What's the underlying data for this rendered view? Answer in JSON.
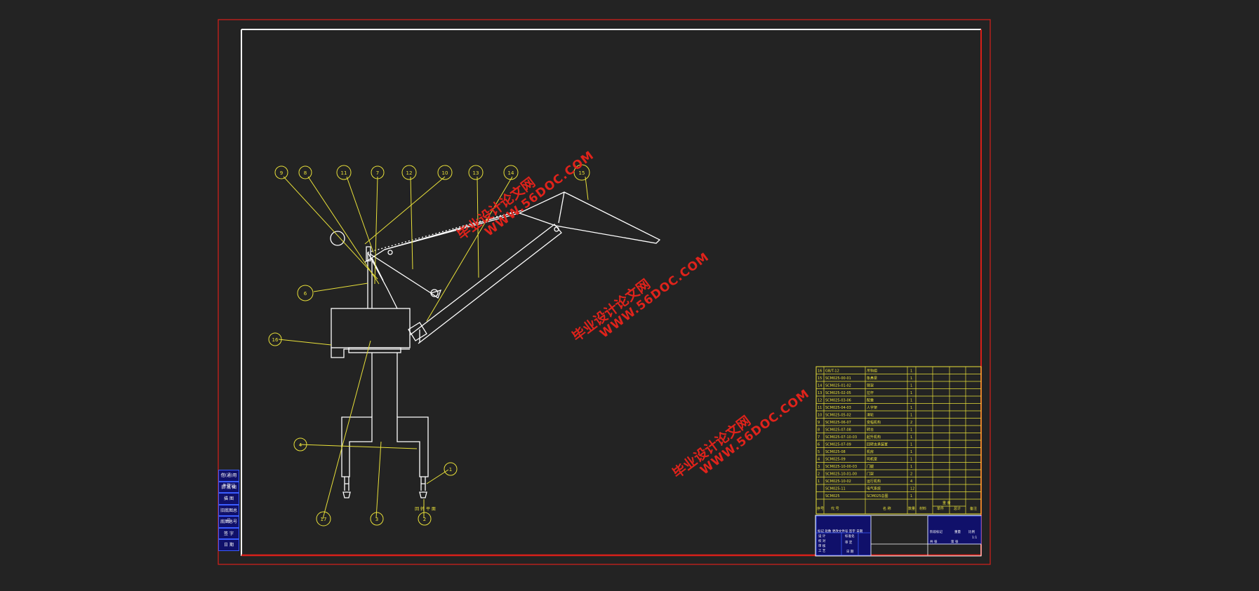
{
  "drawing": {
    "balloons": [
      "9",
      "8",
      "11",
      "7",
      "12",
      "10",
      "13",
      "14",
      "15",
      "16",
      "6",
      "4",
      "17",
      "3",
      "2",
      "1"
    ],
    "ground_note": "回 转 平 面",
    "watermark": {
      "chinese": "毕业设计论文网",
      "url": "WWW.56DOC.COM"
    }
  },
  "side_table": {
    "cells": [
      "借(通)用件登记",
      "旧 底 图",
      "描 图",
      "旧底图总号",
      "底图总号",
      "签 字",
      "日 期"
    ]
  },
  "bom": {
    "rows": [
      {
        "no": "16",
        "code": "GB/T-12",
        "name": "吊钩组",
        "qty": "1"
      },
      {
        "no": "15",
        "code": "SCM025-00-01",
        "name": "象鼻梁",
        "qty": "1"
      },
      {
        "no": "14",
        "code": "SCM025-01-02",
        "name": "臂架",
        "qty": "1"
      },
      {
        "no": "13",
        "code": "SCM025-02-05",
        "name": "拉杆",
        "qty": "1"
      },
      {
        "no": "12",
        "code": "SCM025-03-06",
        "name": "配重",
        "qty": "1"
      },
      {
        "no": "11",
        "code": "SCM025-04-03",
        "name": "人字架",
        "qty": "1"
      },
      {
        "no": "10",
        "code": "SCM025-05-02",
        "name": "滑轮",
        "qty": "1"
      },
      {
        "no": "9",
        "code": "SCM025-06-07",
        "name": "变幅机构",
        "qty": "2"
      },
      {
        "no": "8",
        "code": "SCM025-07-08",
        "name": "转台",
        "qty": "1"
      },
      {
        "no": "7",
        "code": "SCM025-07-10-03",
        "name": "起升机构",
        "qty": "1"
      },
      {
        "no": "6",
        "code": "SCM025-07-09",
        "name": "回转支承装置",
        "qty": "1"
      },
      {
        "no": "5",
        "code": "SCM025-08",
        "name": "机房",
        "qty": "1"
      },
      {
        "no": "4",
        "code": "SCM025-09",
        "name": "司机室",
        "qty": "1"
      },
      {
        "no": "3",
        "code": "SCM025-10-00-03",
        "name": "门腿",
        "qty": "1"
      },
      {
        "no": "2",
        "code": "SCM025-10-01-00",
        "name": "门架",
        "qty": "2"
      },
      {
        "no": "1",
        "code": "SCM025-10-02",
        "name": "运行机构",
        "qty": "4"
      },
      {
        "no": "",
        "code": "SCM025-11",
        "name": "电气系统",
        "qty": "12"
      },
      {
        "no": "",
        "code": "SCM025",
        "name": "SCM025总图",
        "qty": "1"
      }
    ],
    "header": {
      "no": "序号",
      "code": "代 号",
      "name": "名 称",
      "qty": "数量",
      "material": "材料",
      "weight_single": "单件",
      "weight_total": "总计",
      "weight": "重 量",
      "note": "备注"
    }
  },
  "title_block": {
    "left_rows": [
      "标记 处数 更改文件号 签字 日期",
      "设 计",
      "校 对",
      "审 核",
      "工 艺"
    ],
    "mid_rows": [
      "标准化",
      "审 定",
      "日 期"
    ],
    "right_rows": [
      "阶段标记",
      "重量",
      "比例",
      "共 张",
      "第 张",
      "1:1"
    ]
  }
}
